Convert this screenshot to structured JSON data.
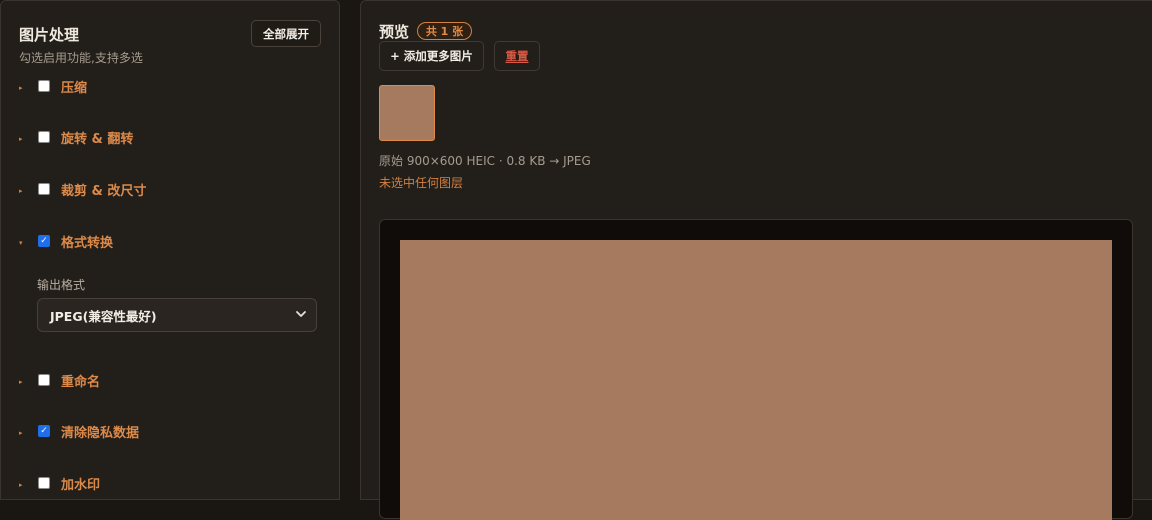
{
  "sidebar": {
    "title": "图片处理",
    "subtitle": "勾选启用功能,支持多选",
    "expand_all_label": "全部展开",
    "features": [
      {
        "label": "压缩",
        "checked": false,
        "expanded": false
      },
      {
        "label": "旋转 & 翻转",
        "checked": false,
        "expanded": false
      },
      {
        "label": "裁剪 & 改尺寸",
        "checked": false,
        "expanded": false
      },
      {
        "label": "格式转换",
        "checked": true,
        "expanded": true
      },
      {
        "label": "重命名",
        "checked": false,
        "expanded": false
      },
      {
        "label": "清除隐私数据",
        "checked": true,
        "expanded": false
      },
      {
        "label": "加水印",
        "checked": false,
        "expanded": false
      }
    ],
    "format_field": {
      "label": "输出格式",
      "selected": "JPEG(兼容性最好)"
    }
  },
  "preview": {
    "title": "预览",
    "count_badge": "共 1 张",
    "add_more_label": "+ 添加更多图片",
    "reset_label": "重置",
    "file_info": "原始 900×600 HEIC · 0.8 KB → JPEG",
    "layer_status": "未选中任何图层"
  },
  "colors": {
    "accent": "#d4813f",
    "image_fill": "#a67a5e",
    "reset_red": "#d85a45",
    "checkbox_blue": "#1f6feb"
  },
  "icons": {
    "caret_collapsed": "▸",
    "caret_expanded": "▾"
  }
}
